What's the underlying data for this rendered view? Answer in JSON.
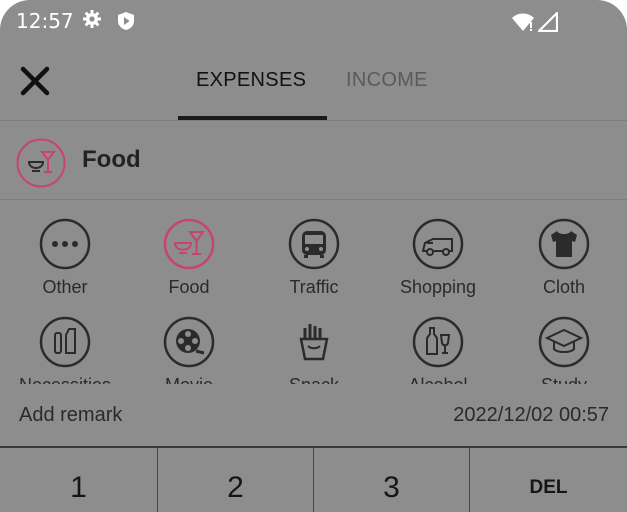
{
  "status_bar": {
    "time": "12:57",
    "icons": [
      "gear-icon",
      "shield-icon",
      "wifi-icon",
      "signal-icon"
    ]
  },
  "header": {
    "tabs": [
      {
        "label": "EXPENSES",
        "active": true
      },
      {
        "label": "INCOME",
        "active": false
      }
    ]
  },
  "selected_category": {
    "label": "Food",
    "icon": "cocktail-icon"
  },
  "categories": [
    {
      "label": "Other",
      "icon": "more-icon"
    },
    {
      "label": "Food",
      "icon": "cocktail-icon",
      "selected": true
    },
    {
      "label": "Traffic",
      "icon": "bus-icon"
    },
    {
      "label": "Shopping",
      "icon": "cart-icon"
    },
    {
      "label": "Cloth",
      "icon": "tshirt-icon"
    },
    {
      "label": "Necessities",
      "icon": "toiletries-icon"
    },
    {
      "label": "Movie",
      "icon": "film-reel-icon"
    },
    {
      "label": "Snack",
      "icon": "fries-icon"
    },
    {
      "label": "Alcohol",
      "icon": "bottle-icon"
    },
    {
      "label": "Study",
      "icon": "graduation-cap-icon"
    }
  ],
  "remark": {
    "placeholder": "Add remark",
    "date": "2022/12/02 00:57"
  },
  "keypad": {
    "keys": [
      "1",
      "2",
      "3",
      "DEL"
    ]
  },
  "colors": {
    "accent": "#c8446e",
    "overlay_bg": "#8d8d8d",
    "icon_stroke": "#2b2b2b"
  }
}
